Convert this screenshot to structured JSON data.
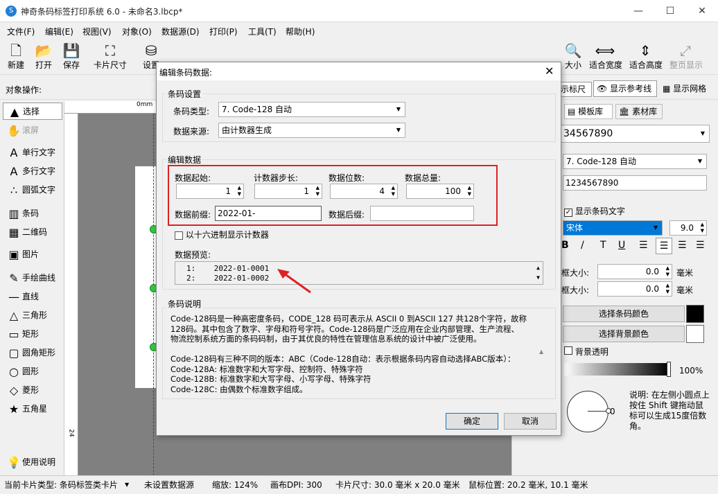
{
  "window": {
    "title": "神奇条码标签打印系统 6.0 - 未命名3.lbcp*",
    "app_icon": "S"
  },
  "menu": [
    "文件(F)",
    "编辑(E)",
    "视图(V)",
    "对象(O)",
    "数据源(D)",
    "打印(P)",
    "工具(T)",
    "帮助(H)"
  ],
  "toolbar": {
    "new": "新建",
    "open": "打开",
    "save": "保存",
    "card_size": "卡片尺寸",
    "settings": "设置",
    "zoom_fit": "大小",
    "fit_width": "适合宽度",
    "fit_height": "适合高度",
    "full_page": "整页显示"
  },
  "objbar": {
    "label": "对象操作:",
    "ruler": "示标尺",
    "guides": "显示参考线",
    "grid": "显示网格"
  },
  "lefttools": [
    {
      "label": "选择",
      "icon": "▲"
    },
    {
      "label": "滚屏",
      "icon": "✋"
    },
    {
      "label": "单行文字",
      "icon": "A"
    },
    {
      "label": "多行文字",
      "icon": "A"
    },
    {
      "label": "圆弧文字",
      "icon": "∴"
    },
    {
      "label": "条码",
      "icon": "▥"
    },
    {
      "label": "二维码",
      "icon": "▦"
    },
    {
      "label": "图片",
      "icon": "▣"
    },
    {
      "label": "手绘曲线",
      "icon": "✎"
    },
    {
      "label": "直线",
      "icon": "—"
    },
    {
      "label": "三角形",
      "icon": "△"
    },
    {
      "label": "矩形",
      "icon": "▭"
    },
    {
      "label": "圆角矩形",
      "icon": "▢"
    },
    {
      "label": "圆形",
      "icon": "○"
    },
    {
      "label": "菱形",
      "icon": "◇"
    },
    {
      "label": "五角星",
      "icon": "★"
    },
    {
      "label": "使用说明",
      "icon": "💡"
    }
  ],
  "ruler": {
    "top": "0mm",
    "left": "24"
  },
  "rightpanel": {
    "tab_templates": "模板库",
    "tab_assets": "素材库",
    "value_combo": "34567890",
    "barcode_type": "7. Code-128 自动",
    "data_value": "1234567890",
    "show_text_label": "显示条码文字",
    "font_name": "宋体",
    "font_size": "9.0",
    "frame_size1_label": "框大小:",
    "frame_size1_value": "0.0",
    "frame_unit1": "毫米",
    "frame_size2_label": "框大小:",
    "frame_size2_value": "0.0",
    "frame_unit2": "毫米",
    "choose_bar_color": "选择条码颜色",
    "choose_bg_color": "选择背景颜色",
    "bg_transparent": "背景透明",
    "opacity": "100%",
    "rotate_value": "0",
    "note": "说明: 在左侧小圆点上按住 Shift 键拖动鼠标可以生成15度倍数角。"
  },
  "status": {
    "card_type": "当前卡片类型: 条码标签类卡片",
    "datasource": "未设置数据源",
    "zoom": "缩放: 124%",
    "dpi": "画布DPI: 300",
    "card_size": "卡片尺寸: 30.0 毫米 x 20.0 毫米",
    "mouse_pos": "鼠标位置: 20.2 毫米, 10.1 毫米"
  },
  "dialog": {
    "title": "编辑条码数据:",
    "group_barcode": "条码设置",
    "type_label": "条码类型:",
    "type_value": "7. Code-128 自动",
    "source_label": "数据来源:",
    "source_value": "由计数器生成",
    "group_edit": "编辑数据",
    "start_label": "数据起始:",
    "start_value": "1",
    "step_label": "计数器步长:",
    "step_value": "1",
    "digits_label": "数据位数:",
    "digits_value": "4",
    "total_label": "数据总量:",
    "total_value": "100",
    "prefix_label": "数据前缀:",
    "prefix_value": "2022-01-",
    "suffix_label": "数据后缀:",
    "suffix_value": "",
    "hex_label": "以十六进制显示计数器",
    "preview_label": "数据预览:",
    "preview_rows": [
      {
        "n": "1:",
        "v": "2022-01-0001"
      },
      {
        "n": "2:",
        "v": "2022-01-0002"
      }
    ],
    "group_desc": "条码说明",
    "desc_lines": [
      "Code-128码是一种高密度条码，CODE_128 码可表示从 ASCII 0 到ASCII 127 共128个字符，故称",
      "128码。其中包含了数字、字母和符号字符。Code-128码是广泛应用在企业内部管理、生产流程、",
      "物流控制系统方面的条码码制，由于其优良的特性在管理信息系统的设计中被广泛使用。",
      "",
      "Code-128码有三种不同的版本：ABC（Code-128自动：表示根据条码内容自动选择ABC版本）：",
      "Code-128A: 标准数字和大写字母、控制符、特殊字符",
      "Code-128B: 标准数字和大写字母、小写字母、特殊字符",
      "Code-128C: 由偶数个标准数字组成。"
    ],
    "ok": "确定",
    "cancel": "取消",
    "highlight_color": "#e02020"
  }
}
